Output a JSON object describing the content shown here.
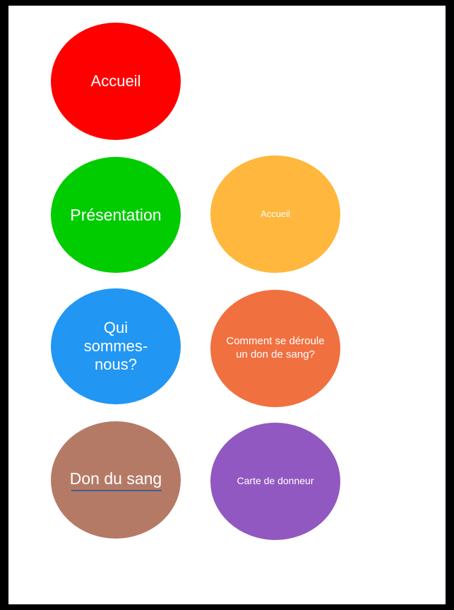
{
  "menu": {
    "accueil": {
      "label": "Accueil",
      "color": "#ff0000"
    },
    "presentation": {
      "label": "Présentation",
      "color": "#00cc00"
    },
    "qui_sommes_nous": {
      "label": "Qui sommes-nous?",
      "color": "#2196f3"
    },
    "don_du_sang": {
      "label": "Don du sang",
      "color": "#b57a66"
    }
  },
  "submenu": {
    "accueil": {
      "label": "Accueil",
      "color": "#ffb73d"
    },
    "deroulement": {
      "label": "Comment se déroule un don de sang?",
      "color": "#f07040"
    },
    "carte": {
      "label": "Carte de donneur",
      "color": "#9158c1"
    }
  }
}
